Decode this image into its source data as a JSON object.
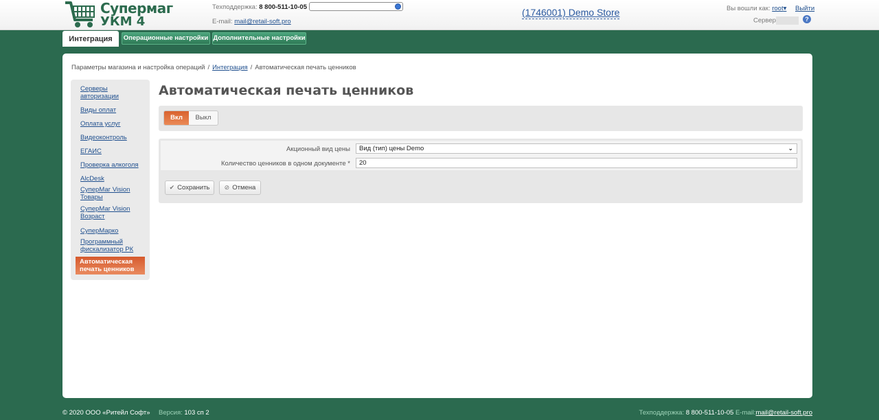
{
  "header": {
    "logo_line1": "Супермаг",
    "logo_line2": "УКМ 4",
    "support_label": "Техподдержка:",
    "support_phone": "8 800-511-10-05",
    "email_label": "E-mail:",
    "email": "mail@retail-soft.pro",
    "store_name": "(1746001) Demo Store",
    "login_label": "Вы вошли как:",
    "user": "root",
    "logout": "Выйти",
    "server_label": "Сервер",
    "help_icon": "question-circle-icon"
  },
  "topnav": {
    "tabs": [
      {
        "label": "Интеграция",
        "active": true
      },
      {
        "label": "Операционные настройки",
        "active": false
      },
      {
        "label": "Дополнительные настройки",
        "active": false
      }
    ]
  },
  "breadcrumb": {
    "root": "Параметры магазина и настройка операций",
    "section": "Интеграция",
    "current": "Автоматическая печать ценников",
    "separator": "/"
  },
  "sidebar": {
    "items": [
      {
        "label": "Серверы авторизации"
      },
      {
        "label": "Виды оплат"
      },
      {
        "label": "Оплата услуг"
      },
      {
        "label": "Видеоконтроль"
      },
      {
        "label": "ЕГАИС"
      },
      {
        "label": "Проверка алкоголя"
      },
      {
        "label": "AlcDesk"
      },
      {
        "label": "СуперМаг Vision Товары"
      },
      {
        "label": "СуперМаг Vision Возраст"
      },
      {
        "label": "СуперМарко"
      },
      {
        "label": "Программный фискализатор РК"
      },
      {
        "label": "Автоматическая печать ценников",
        "active": true
      }
    ]
  },
  "main": {
    "title": "Автоматическая печать ценников",
    "toggle": {
      "on_label": "Вкл",
      "off_label": "Выкл",
      "selected": "on"
    },
    "form": {
      "price_type_label": "Акционный вид цены",
      "price_type_value": "Вид (тип) цены Demo",
      "count_label": "Количество ценников в одном документе",
      "required_mark": "*",
      "count_value": "20"
    },
    "buttons": {
      "save": "Сохранить",
      "cancel": "Отмена"
    }
  },
  "footer": {
    "copyright": "© 2020 ООО «Ритейл Софт»",
    "version_label": "Версия:",
    "version": "103 сп 2",
    "support_label": "Техподдержка:",
    "support_phone": "8 800-511-10-05",
    "email_label": "E-mail:",
    "email": "mail@retail-soft.pro"
  },
  "colors": {
    "brand_green": "#2c6b4e",
    "background_green": "#2b6a4f",
    "accent_orange": "#d9622f",
    "link_blue": "#1f4f8e"
  }
}
